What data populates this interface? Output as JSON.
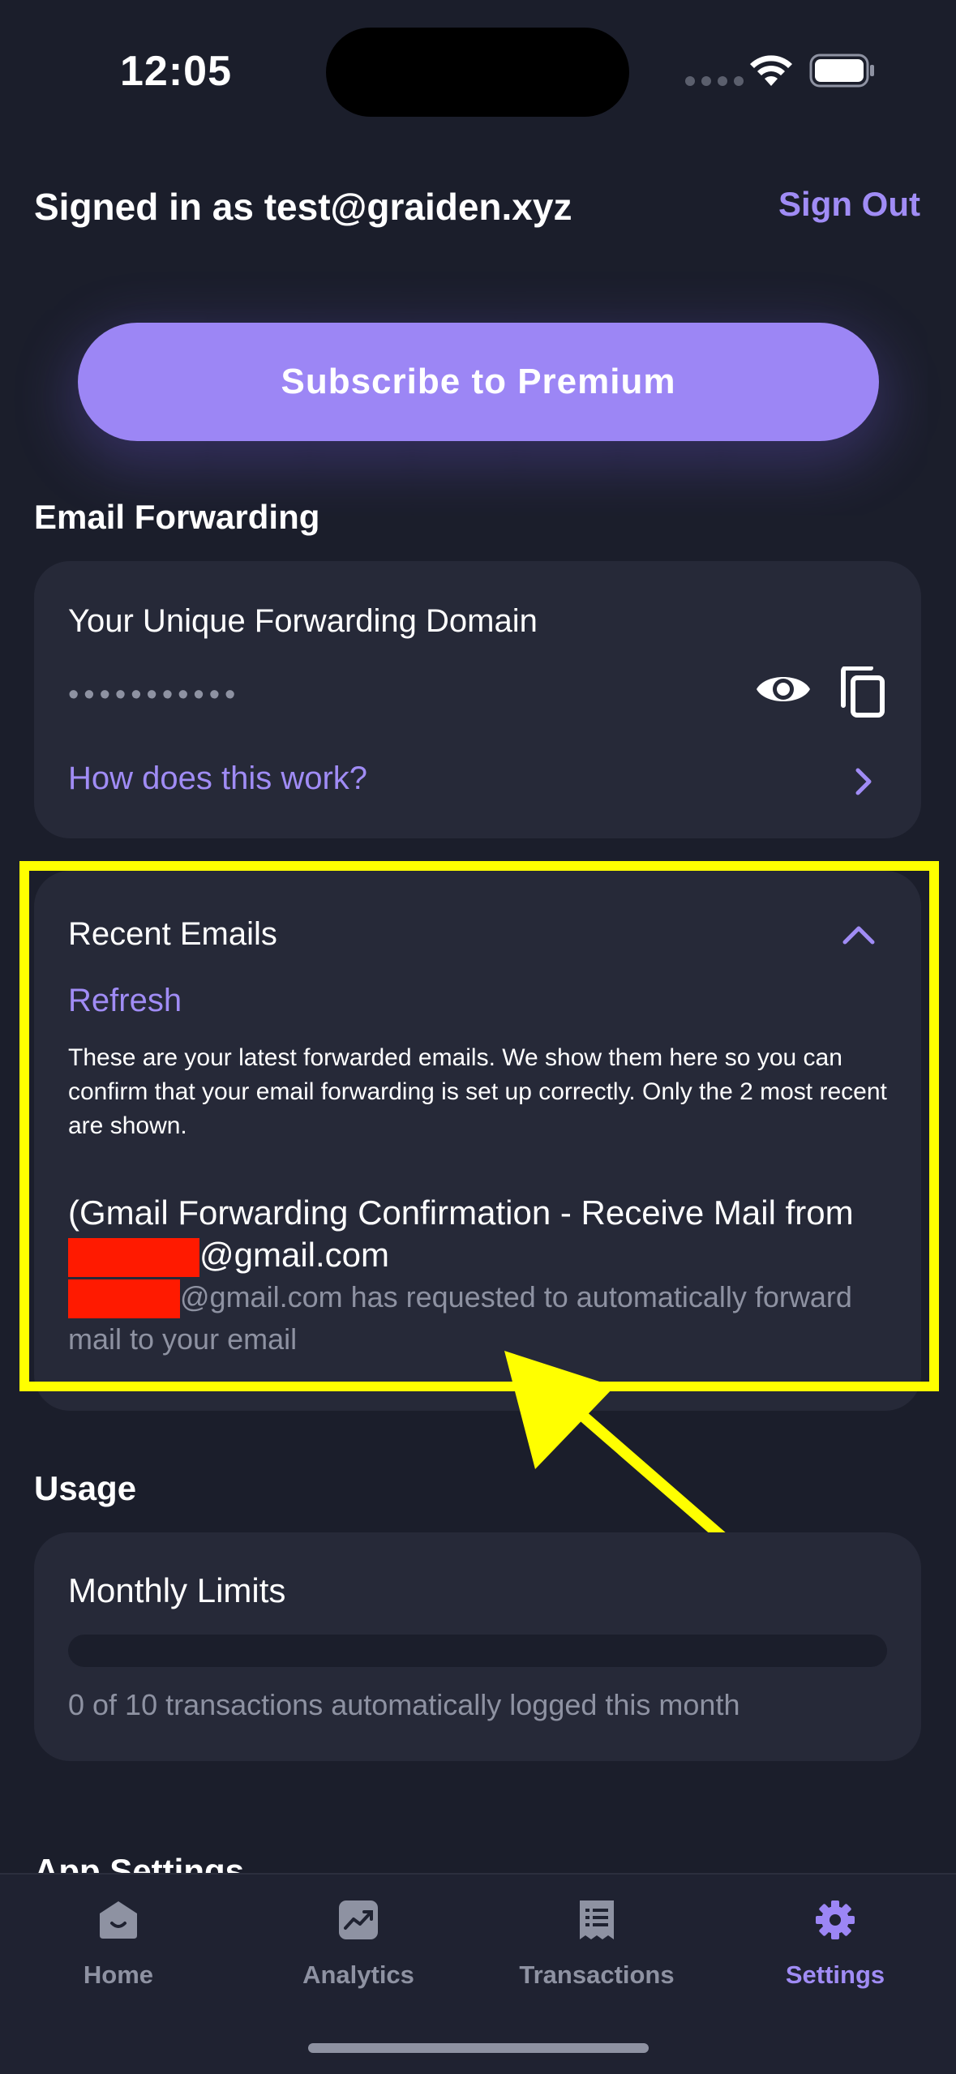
{
  "status_bar": {
    "time": "12:05"
  },
  "header": {
    "signed_in_text": "Signed in as test@graiden.xyz",
    "sign_out_label": "Sign Out"
  },
  "premium": {
    "button_label": "Subscribe to Premium"
  },
  "email_forwarding": {
    "section_title": "Email Forwarding",
    "domain_title": "Your Unique Forwarding Domain",
    "masked_value": "•••••••••••",
    "how_link": "How does this work?",
    "icons": [
      "eye-icon",
      "copy-icon",
      "chevron-right-icon"
    ]
  },
  "recent_emails": {
    "title": "Recent Emails",
    "refresh_label": "Refresh",
    "description": "These are your latest forwarded emails. We show them here so you can confirm that your email forwarding is set up correctly. Only the 2 most recent are shown.",
    "email": {
      "subject_prefix": "(Gmail Forwarding Confirmation - Receive Mail from ",
      "subject_suffix": "@gmail.com",
      "body_suffix": "@gmail.com has requested to automatically forward mail to your email"
    }
  },
  "usage": {
    "section_title": "Usage",
    "card_title": "Monthly Limits",
    "progress_fraction": 0,
    "summary": "0 of 10 transactions automatically logged this month"
  },
  "app_settings": {
    "section_title": "App Settings"
  },
  "tabs": [
    {
      "label": "Home",
      "icon": "home-icon",
      "active": false
    },
    {
      "label": "Analytics",
      "icon": "analytics-icon",
      "active": false
    },
    {
      "label": "Transactions",
      "icon": "receipt-icon",
      "active": false
    },
    {
      "label": "Settings",
      "icon": "gear-icon",
      "active": true
    }
  ],
  "colors": {
    "accent": "#9c86f5",
    "background": "#1b1e2b",
    "card": "#262938",
    "highlight": "#ffff00",
    "redaction": "#ff1a00"
  }
}
